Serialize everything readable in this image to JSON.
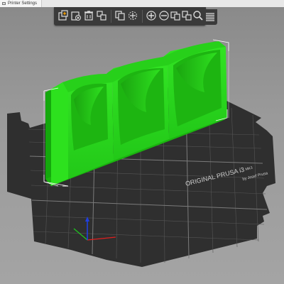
{
  "window": {
    "tab_label": "Printer Settings"
  },
  "toolbar": {
    "buttons": [
      {
        "name": "add-icon",
        "title": "Add"
      },
      {
        "name": "delete-icon",
        "title": "Delete"
      },
      {
        "name": "delete-all-icon",
        "title": "Delete all"
      },
      {
        "name": "arrange-icon",
        "title": "Arrange"
      },
      {
        "name": "copy-icon",
        "title": "Copy"
      },
      {
        "name": "paste-icon",
        "title": "Paste"
      },
      {
        "name": "add-instance-icon",
        "title": "Add instance"
      },
      {
        "name": "remove-instance-icon",
        "title": "Remove instance"
      },
      {
        "name": "split-objects-icon",
        "title": "Split to objects"
      },
      {
        "name": "split-parts-icon",
        "title": "Split to parts"
      },
      {
        "name": "search-icon",
        "title": "Search"
      },
      {
        "name": "layers-editing-icon",
        "title": "Variable layer height"
      }
    ]
  },
  "bed": {
    "brand_text": "ORIGINAL PRUSA i3",
    "model_text": "MK3",
    "maker_text": "by Josef Prusa"
  },
  "colors": {
    "model_green": "#2bdc1c",
    "model_dark": "#14a80c",
    "bed": "#2f2f2f",
    "grid": "#5a5a5a",
    "axis_x": "#e02020",
    "axis_y": "#1ec81e",
    "axis_z": "#2040e0"
  }
}
